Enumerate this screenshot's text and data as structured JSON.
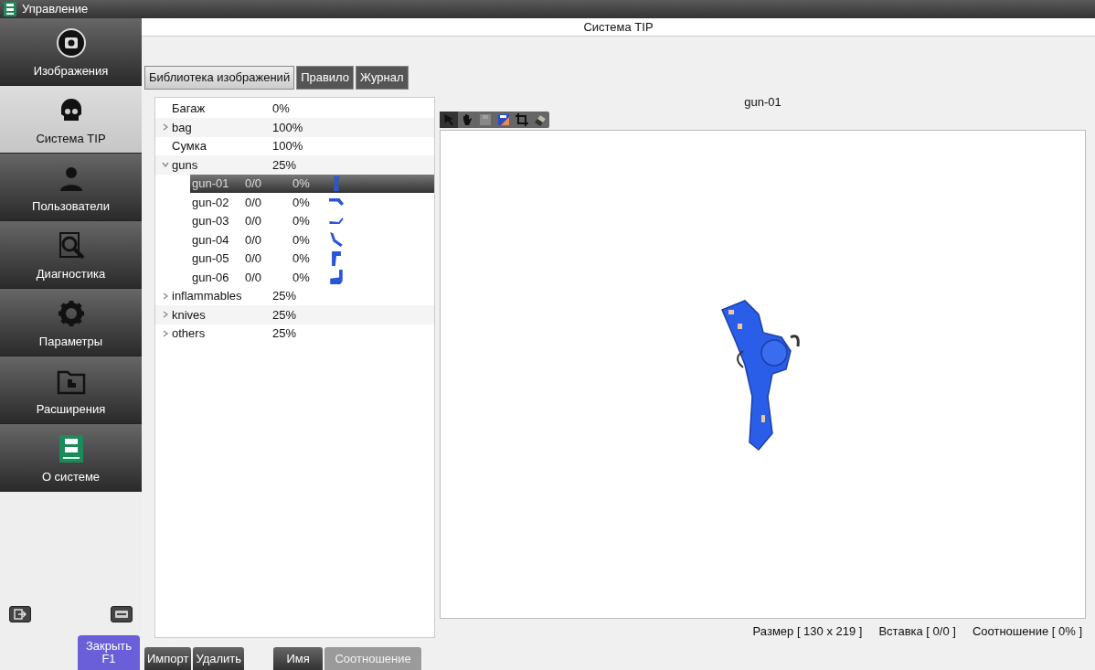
{
  "window": {
    "title": "Управление"
  },
  "sidebar": {
    "items": [
      {
        "label": "Изображения",
        "selected": false
      },
      {
        "label": "Система TIP",
        "selected": true
      },
      {
        "label": "Пользователи",
        "selected": false
      },
      {
        "label": "Диагностика",
        "selected": false
      },
      {
        "label": "Параметры",
        "selected": false
      },
      {
        "label": "Расширения",
        "selected": false
      },
      {
        "label": "О системе",
        "selected": false
      }
    ],
    "close_button": {
      "label": "Закрыть",
      "shortcut": "F1"
    }
  },
  "header": {
    "title": "Система TIP"
  },
  "tabs": [
    {
      "label": "Библиотека изображений",
      "selected": true
    },
    {
      "label": "Правило",
      "selected": false
    },
    {
      "label": "Журнал",
      "selected": false
    }
  ],
  "tree": [
    {
      "kind": "heading",
      "name": "Багаж",
      "value": "0%"
    },
    {
      "kind": "category",
      "name": "bag",
      "value": "100%",
      "expanded": false
    },
    {
      "kind": "heading",
      "name": "Сумка",
      "value": "100%"
    },
    {
      "kind": "category",
      "name": "guns",
      "value": "25%",
      "expanded": true,
      "children": [
        {
          "kind": "image",
          "name": "gun-01",
          "insert": "0/0",
          "ratio": "0%",
          "selected": true
        },
        {
          "kind": "image",
          "name": "gun-02",
          "insert": "0/0",
          "ratio": "0%",
          "selected": false
        },
        {
          "kind": "image",
          "name": "gun-03",
          "insert": "0/0",
          "ratio": "0%",
          "selected": false
        },
        {
          "kind": "image",
          "name": "gun-04",
          "insert": "0/0",
          "ratio": "0%",
          "selected": false
        },
        {
          "kind": "image",
          "name": "gun-05",
          "insert": "0/0",
          "ratio": "0%",
          "selected": false
        },
        {
          "kind": "image",
          "name": "gun-06",
          "insert": "0/0",
          "ratio": "0%",
          "selected": false
        }
      ]
    },
    {
      "kind": "category",
      "name": "inflammables",
      "value": "25%",
      "expanded": false
    },
    {
      "kind": "category",
      "name": "knives",
      "value": "25%",
      "expanded": false
    },
    {
      "kind": "category",
      "name": "others",
      "value": "25%",
      "expanded": false
    }
  ],
  "preview": {
    "title": "gun-01",
    "toolbar": [
      {
        "kind": "pointer",
        "selected": true,
        "disabled": false
      },
      {
        "kind": "hand",
        "selected": false,
        "disabled": false
      },
      {
        "kind": "save",
        "selected": false,
        "disabled": true
      },
      {
        "kind": "color",
        "selected": false,
        "disabled": false
      },
      {
        "kind": "crop",
        "selected": false,
        "disabled": false
      },
      {
        "kind": "eraser",
        "selected": false,
        "disabled": false
      }
    ],
    "status": [
      "Размер [ 130 x 219 ]",
      "Вставка [ 0/0 ]",
      "Соотношение [ 0% ]"
    ]
  },
  "actions": [
    "Импорт",
    "Удалить"
  ],
  "sort_buttons": [
    {
      "label": "Имя",
      "selected": true
    },
    {
      "label": "Соотношение",
      "selected": false
    }
  ]
}
